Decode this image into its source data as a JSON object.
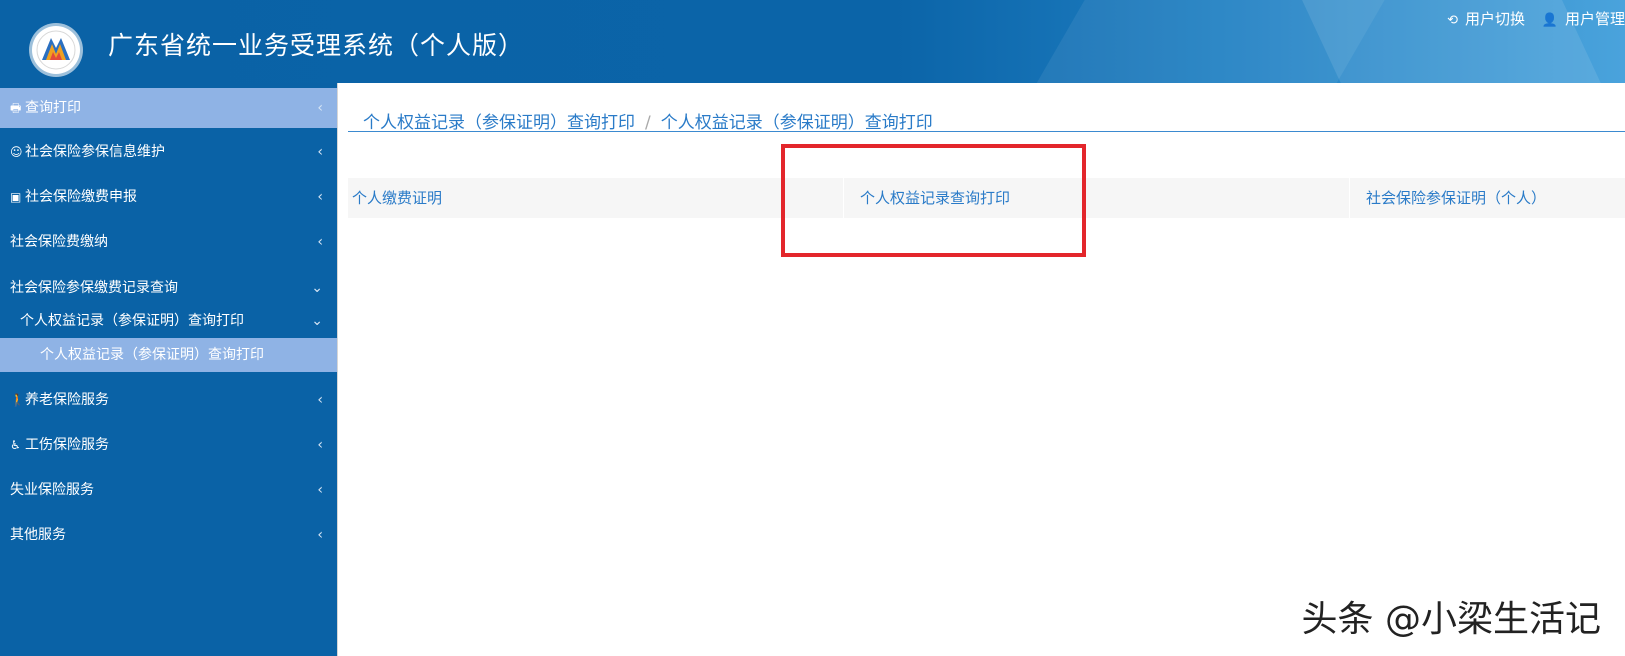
{
  "header": {
    "title": "广东省统一业务受理系统（个人版）",
    "user_switch": "用户切换",
    "user_manage": "用户管理"
  },
  "sidebar": {
    "items": [
      {
        "label": "查询打印",
        "icon": "printer-icon"
      },
      {
        "label": "社会保险参保信息维护",
        "icon": "user-icon"
      },
      {
        "label": "社会保险缴费申报",
        "icon": "money-icon"
      },
      {
        "label": "社会保险费缴纳"
      },
      {
        "label": "社会保险参保缴费记录查询"
      },
      {
        "label": "个人权益记录（参保证明）查询打印"
      },
      {
        "label": "个人权益记录（参保证明）查询打印"
      },
      {
        "label": "养老保险服务",
        "icon": "walking-person-icon"
      },
      {
        "label": "工伤保险服务",
        "icon": "wheelchair-icon"
      },
      {
        "label": "失业保险服务"
      },
      {
        "label": "其他服务"
      }
    ]
  },
  "breadcrumb": {
    "parent": "个人权益记录（参保证明）查询打印",
    "separator": "/",
    "current": "个人权益记录（参保证明）查询打印"
  },
  "options": [
    "个人缴费证明",
    "个人权益记录查询打印",
    "社会保险参保证明（个人）"
  ],
  "watermark": "头条 @小梁生活记",
  "colors": {
    "header_bg": "#0a62a6",
    "sidebar_bg": "#0a62a6",
    "sidebar_active": "#8fb3e5",
    "link": "#2a7bc8",
    "highlight_border": "#e3262b"
  }
}
